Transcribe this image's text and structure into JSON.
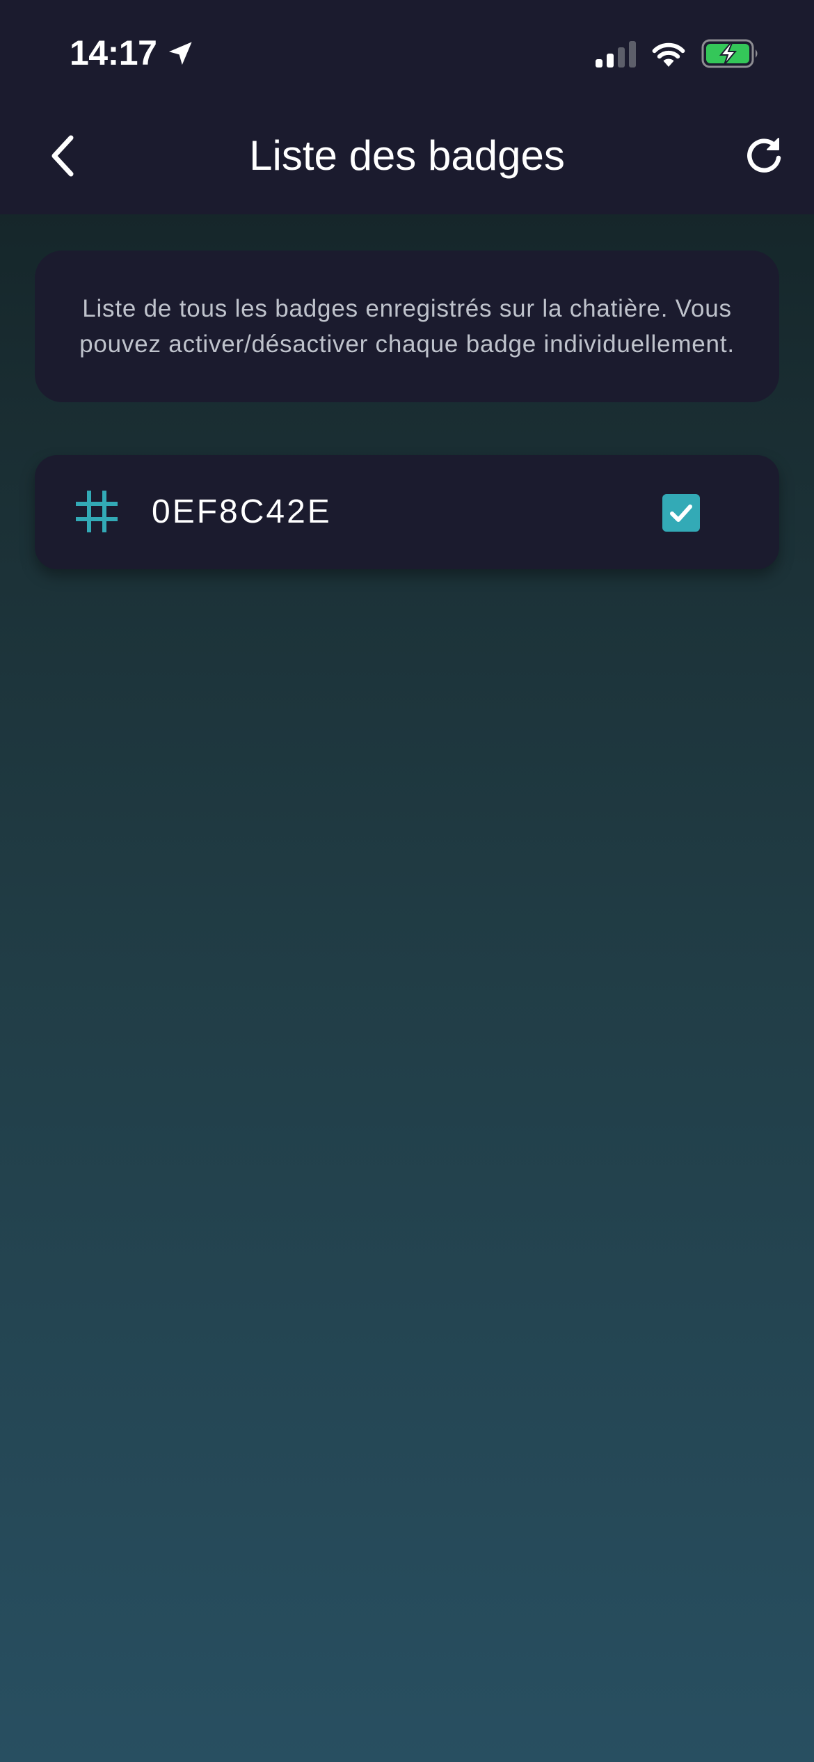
{
  "status_bar": {
    "time": "14:17",
    "icons": [
      "location-icon",
      "signal-icon",
      "wifi-icon",
      "battery-charging-icon"
    ]
  },
  "header": {
    "title": "Liste des badges",
    "back_icon": "chevron-left-icon",
    "refresh_icon": "refresh-icon"
  },
  "info": {
    "text": "Liste de tous les badges enregistrés sur la chatière. Vous pouvez activer/désactiver chaque badge individuellement."
  },
  "badges": [
    {
      "id": "0EF8C42E",
      "icon": "hash-icon",
      "enabled": true
    }
  ],
  "colors": {
    "header_background": "#1b1b2e",
    "card_background": "#1b1b2e",
    "accent": "#33aab6",
    "battery_green": "#34c759"
  }
}
